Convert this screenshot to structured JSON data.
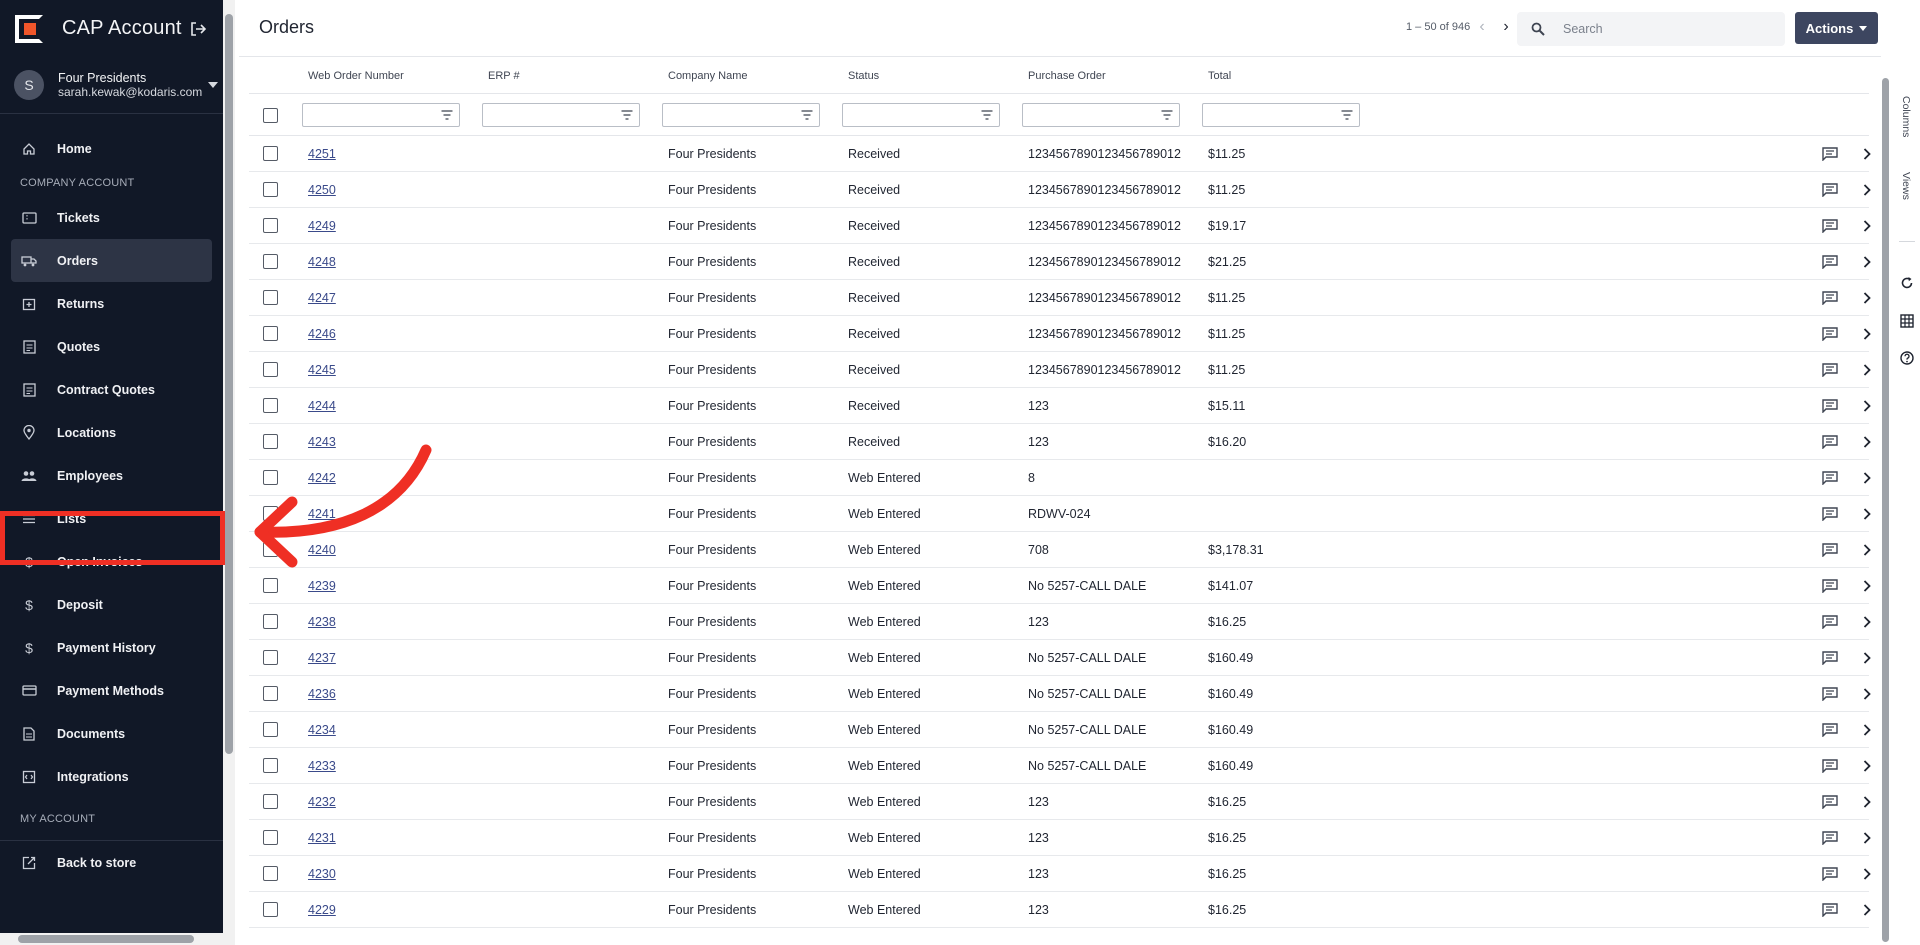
{
  "app": {
    "title": "CAP Account"
  },
  "user": {
    "initial": "S",
    "name": "Four Presidents",
    "email": "sarah.kewak@kodaris.com"
  },
  "nav": {
    "home": "Home",
    "section_company": "COMPANY ACCOUNT",
    "items": [
      {
        "label": "Tickets",
        "icon": "ticket-icon"
      },
      {
        "label": "Orders",
        "icon": "truck-icon"
      },
      {
        "label": "Returns",
        "icon": "return-icon"
      },
      {
        "label": "Quotes",
        "icon": "clipboard-icon"
      },
      {
        "label": "Contract Quotes",
        "icon": "clipboard-icon"
      },
      {
        "label": "Locations",
        "icon": "location-pin-icon"
      },
      {
        "label": "Employees",
        "icon": "people-icon"
      },
      {
        "label": "Lists",
        "icon": "list-icon"
      },
      {
        "label": "Open Invoices",
        "icon": "dollar-icon"
      },
      {
        "label": "Deposit",
        "icon": "dollar-icon"
      },
      {
        "label": "Payment History",
        "icon": "dollar-icon"
      },
      {
        "label": "Payment Methods",
        "icon": "credit-card-icon"
      },
      {
        "label": "Documents",
        "icon": "document-icon"
      },
      {
        "label": "Integrations",
        "icon": "integration-icon"
      }
    ],
    "active": "Orders",
    "section_my": "MY ACCOUNT",
    "back": "Back to store"
  },
  "page": {
    "title": "Orders",
    "pager": "1 – 50 of 946",
    "search_placeholder": "Search",
    "actions_label": "Actions"
  },
  "table": {
    "columns": [
      "Web Order Number",
      "ERP #",
      "Company Name",
      "Status",
      "Purchase Order",
      "Total"
    ],
    "rows": [
      [
        "4251",
        "",
        "Four Presidents",
        "Received",
        "123456789012345678901​2",
        "$11.25"
      ],
      [
        "4250",
        "",
        "Four Presidents",
        "Received",
        "1234567890123456789012",
        "$11.25"
      ],
      [
        "4249",
        "",
        "Four Presidents",
        "Received",
        "1234567890123456789012",
        "$19.17"
      ],
      [
        "4248",
        "",
        "Four Presidents",
        "Received",
        "1234567890123456789012",
        "$21.25"
      ],
      [
        "4247",
        "",
        "Four Presidents",
        "Received",
        "1234567890123456789012",
        "$11.25"
      ],
      [
        "4246",
        "",
        "Four Presidents",
        "Received",
        "1234567890123456789012",
        "$11.25"
      ],
      [
        "4245",
        "",
        "Four Presidents",
        "Received",
        "1234567890123456789012",
        "$11.25"
      ],
      [
        "4244",
        "",
        "Four Presidents",
        "Received",
        "123",
        "$15.11"
      ],
      [
        "4243",
        "",
        "Four Presidents",
        "Received",
        "123",
        "$16.20"
      ],
      [
        "4242",
        "",
        "Four Presidents",
        "Web Entered",
        "8",
        ""
      ],
      [
        "4241",
        "",
        "Four Presidents",
        "Web Entered",
        "RDWV-024",
        ""
      ],
      [
        "4240",
        "",
        "Four Presidents",
        "Web Entered",
        "708",
        "$3,178.31"
      ],
      [
        "4239",
        "",
        "Four Presidents",
        "Web Entered",
        "No 5257-CALL DALE",
        "$141.07"
      ],
      [
        "4238",
        "",
        "Four Presidents",
        "Web Entered",
        "123",
        "$16.25"
      ],
      [
        "4237",
        "",
        "Four Presidents",
        "Web Entered",
        "No 5257-CALL DALE",
        "$160.49"
      ],
      [
        "4236",
        "",
        "Four Presidents",
        "Web Entered",
        "No 5257-CALL DALE",
        "$160.49"
      ],
      [
        "4234",
        "",
        "Four Presidents",
        "Web Entered",
        "No 5257-CALL DALE",
        "$160.49"
      ],
      [
        "4233",
        "",
        "Four Presidents",
        "Web Entered",
        "No 5257-CALL DALE",
        "$160.49"
      ],
      [
        "4232",
        "",
        "Four Presidents",
        "Web Entered",
        "123",
        "$16.25"
      ],
      [
        "4231",
        "",
        "Four Presidents",
        "Web Entered",
        "123",
        "$16.25"
      ],
      [
        "4230",
        "",
        "Four Presidents",
        "Web Entered",
        "123",
        "$16.25"
      ],
      [
        "4229",
        "",
        "Four Presidents",
        "Web Entered",
        "123",
        "$16.25"
      ]
    ]
  },
  "rail": {
    "columns": "Columns",
    "views": "Views"
  },
  "colors": {
    "sidebar": "#111827",
    "accent": "#3d4660",
    "annotation": "#ef2f24",
    "link": "#3a4a8a"
  }
}
